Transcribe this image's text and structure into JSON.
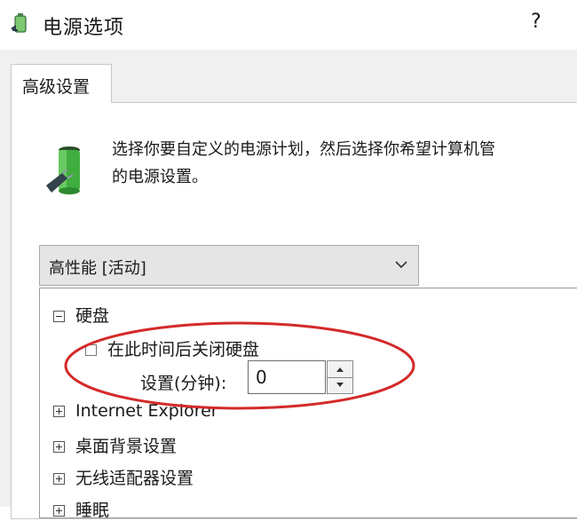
{
  "window": {
    "title": "电源选项",
    "help_label": "?"
  },
  "tabs": [
    {
      "label": "高级设置"
    }
  ],
  "description": {
    "line1": "选择你要自定义的电源计划，然后选择你希望计算机管",
    "line2": "的电源设置。"
  },
  "plan_select": {
    "value": "高性能 [活动]"
  },
  "tree": {
    "hard_disk": {
      "label": "硬盘",
      "child_label": "在此时间后关闭硬盘",
      "setting_label": "设置(分钟):",
      "setting_value": "0"
    },
    "items": [
      {
        "label": "Internet Explorer"
      },
      {
        "label": "桌面背景设置"
      },
      {
        "label": "无线适配器设置"
      },
      {
        "label": "睡眠"
      }
    ]
  },
  "colors": {
    "annotation": "#d42a2a",
    "battery": "#3fae3f"
  }
}
